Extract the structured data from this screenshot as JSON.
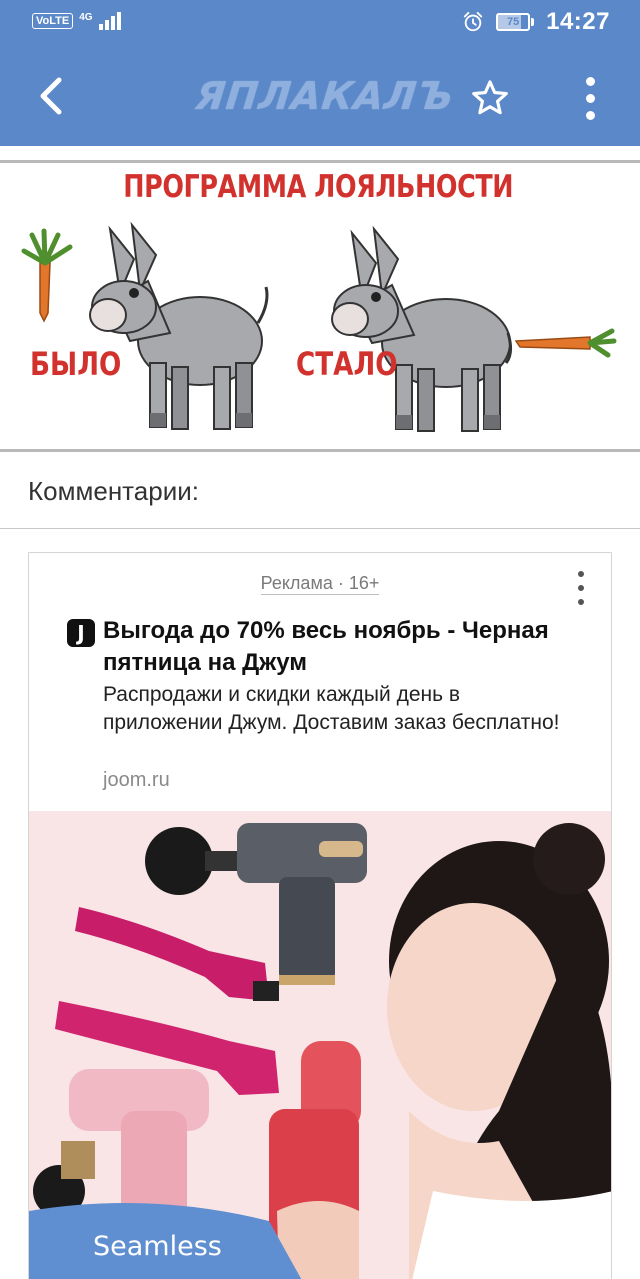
{
  "status_bar": {
    "volte": "VoLTE",
    "network": "4G",
    "battery_level": "75",
    "time": "14:27"
  },
  "app_bar": {
    "back_icon": "chevron-left-icon",
    "logo_text": "ЯПЛАКАЛЪ",
    "favorite_icon": "star-outline-icon",
    "menu_icon": "more-vertical-icon"
  },
  "post": {
    "meme_title": "ПРОГРАММА ЛОЯЛЬНОСТИ",
    "left_label": "БЫЛО",
    "right_label": "СТАЛО"
  },
  "comments": {
    "title": "Комментарии:"
  },
  "ad": {
    "label": "Реклама · 16+",
    "favicon_letter": "J",
    "headline": "Выгода до 70% весь ноябрь - Черная пятница на Джум",
    "description": "Распродажи и скидки каждый день в приложении Джум. Доставим заказ бесплатно!",
    "domain": "joom.ru",
    "image_caption": "Seamless"
  },
  "colors": {
    "primary": "#5b88c8",
    "meme_red": "#d2322d"
  }
}
